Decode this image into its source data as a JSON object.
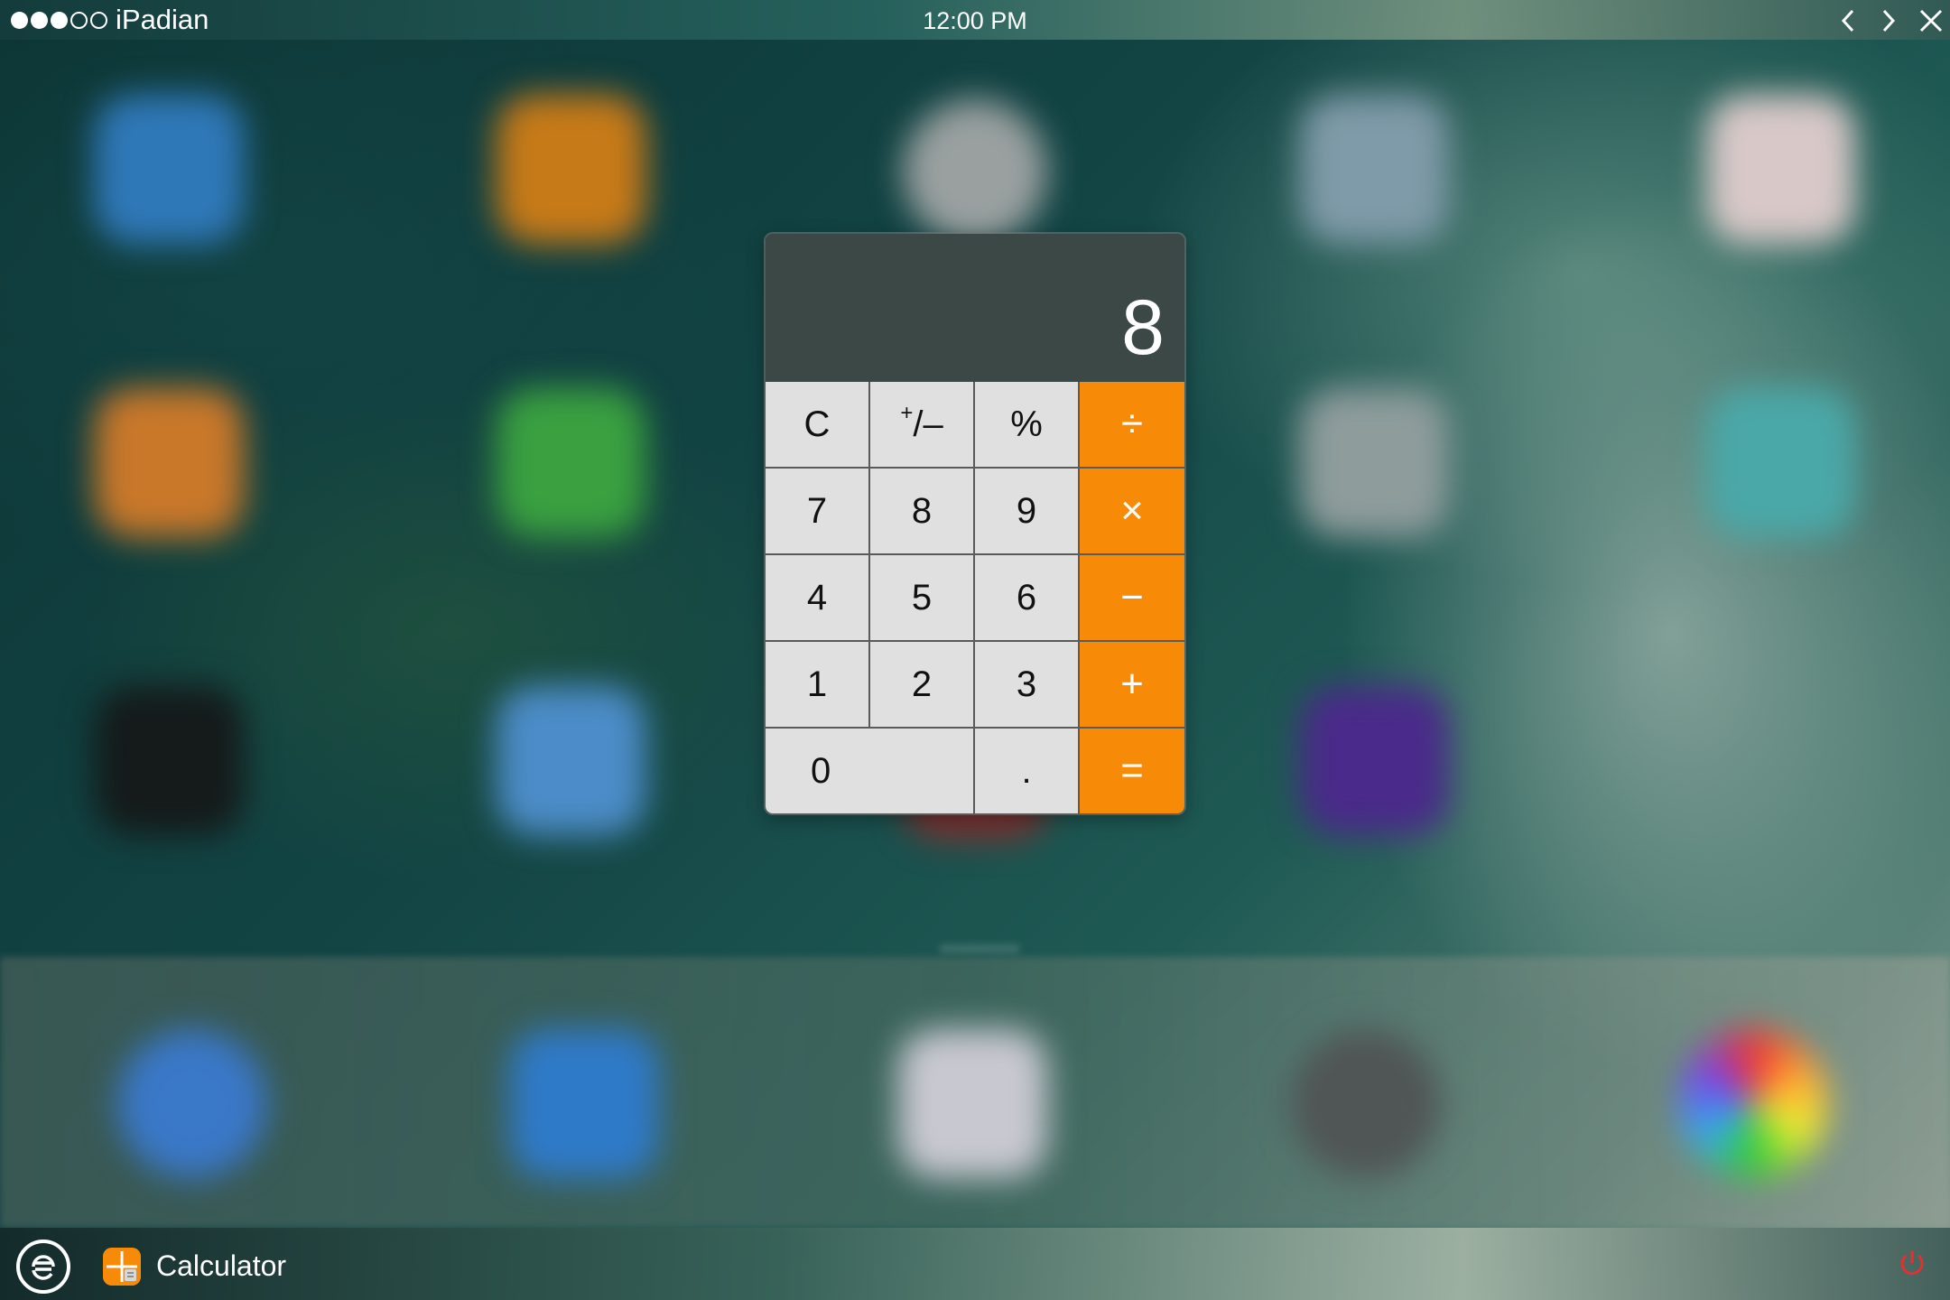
{
  "topbar": {
    "signal_dots": [
      true,
      true,
      true,
      false,
      false
    ],
    "carrier": "iPadian",
    "time": "12:00 PM",
    "back_icon": "chevron-left-icon",
    "forward_icon": "chevron-right-icon",
    "close_icon": "close-icon"
  },
  "calculator": {
    "display": "8",
    "keys": {
      "clear": "C",
      "sign_plus": "+",
      "sign_rest": "/–",
      "percent": "%",
      "divide": "÷",
      "seven": "7",
      "eight": "8",
      "nine": "9",
      "multiply": "×",
      "four": "4",
      "five": "5",
      "six": "6",
      "minus": "−",
      "one": "1",
      "two": "2",
      "three": "3",
      "plus": "+",
      "zero": "0",
      "decimal": ".",
      "equals": "="
    },
    "colors": {
      "operator": "#f78a07",
      "key": "#e0e0e0",
      "display_bg": "#3c4846"
    }
  },
  "taskbar": {
    "home_icon": "ipadian-home-icon",
    "app_icon": "calculator-app-icon",
    "app_name": "Calculator",
    "power_icon": "power-icon",
    "power_color": "#e53030"
  }
}
